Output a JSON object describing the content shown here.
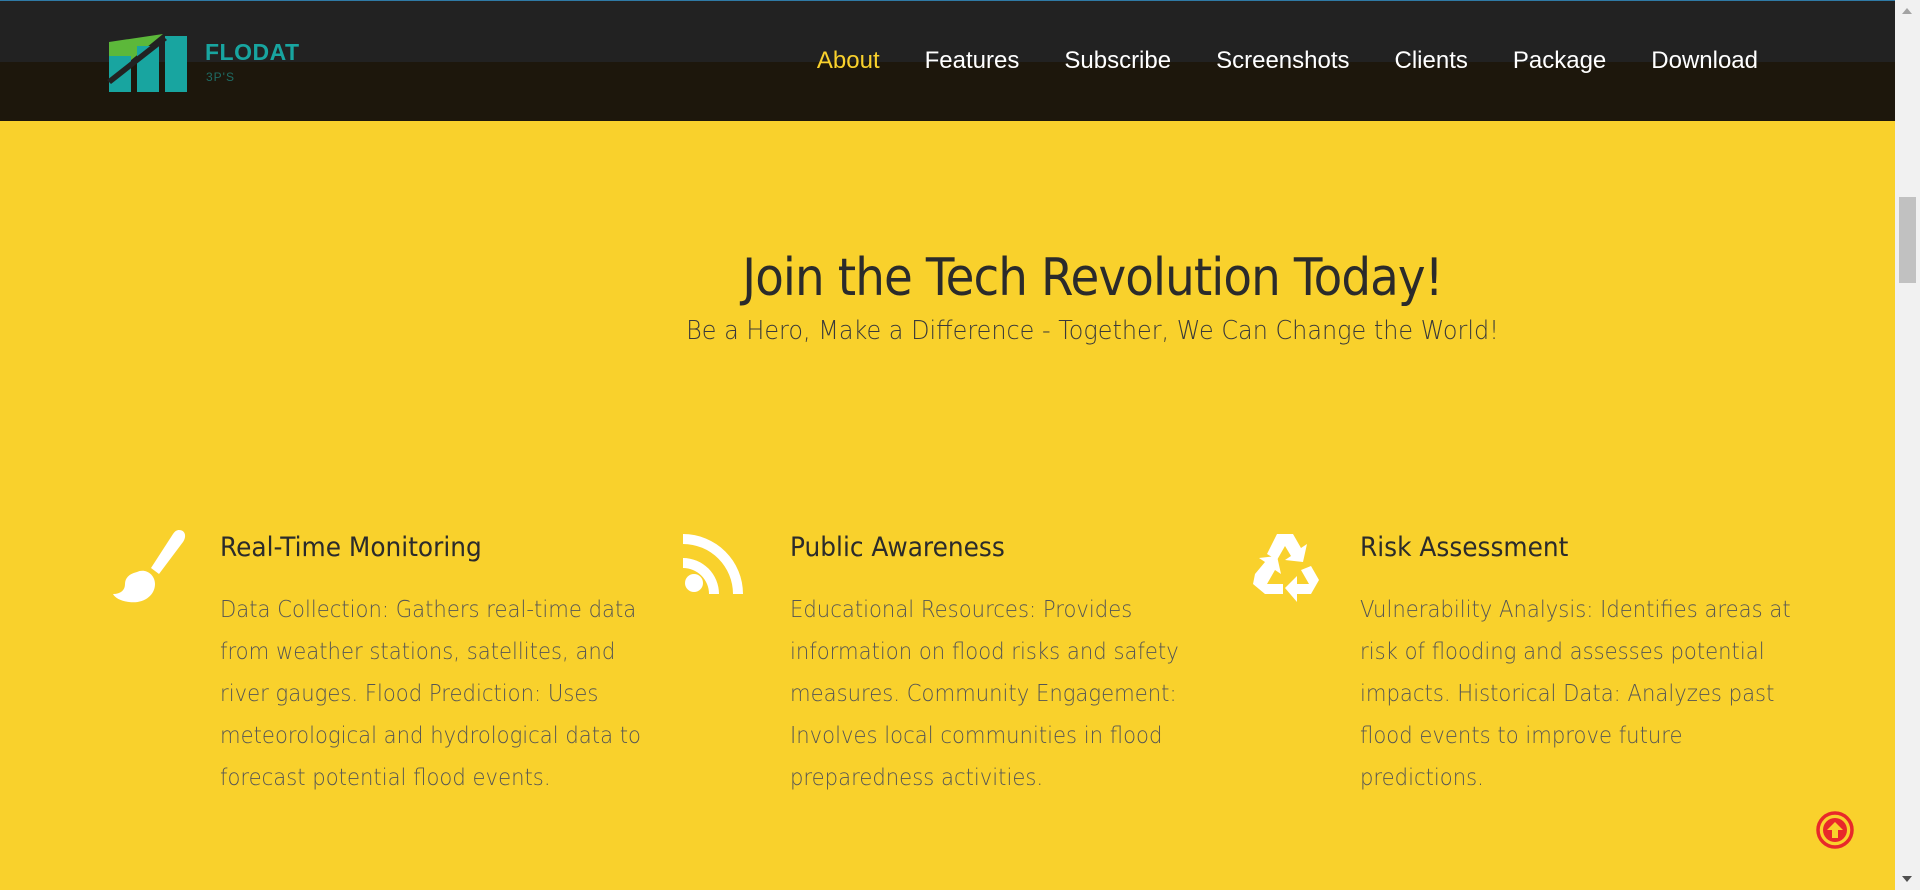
{
  "brand": {
    "name": "FLODAT",
    "subtitle": "3P'S"
  },
  "nav": {
    "items": [
      {
        "label": "About",
        "active": true
      },
      {
        "label": "Features",
        "active": false
      },
      {
        "label": "Subscribe",
        "active": false
      },
      {
        "label": "Screenshots",
        "active": false
      },
      {
        "label": "Clients",
        "active": false
      },
      {
        "label": "Package",
        "active": false
      },
      {
        "label": "Download",
        "active": false
      }
    ]
  },
  "hero": {
    "title": "Join the Tech Revolution Today!",
    "subtitle": "Be a Hero, Make a Difference - Together, We Can Change the World!"
  },
  "features": [
    {
      "icon": "paintbrush-icon",
      "title": "Real-Time Monitoring",
      "text": "Data Collection: Gathers real-time data from weather stations, satellites, and river gauges. Flood Prediction: Uses meteorological and hydrological data to forecast potential flood events."
    },
    {
      "icon": "rss-icon",
      "title": "Public Awareness",
      "text": "Educational Resources: Provides information on flood risks and safety measures. Community Engagement: Involves local communities in flood preparedness activities."
    },
    {
      "icon": "recycle-icon",
      "title": "Risk Assessment",
      "text": "Vulnerability Analysis: Identifies areas at risk of flooding and assesses potential impacts. Historical Data: Analyzes past flood events to improve future predictions."
    }
  ],
  "colors": {
    "background": "#f9d12c",
    "navbar": "#222222",
    "accent": "#f9d12c",
    "brand": "#18a5a0",
    "back_to_top": "#e8292a"
  }
}
